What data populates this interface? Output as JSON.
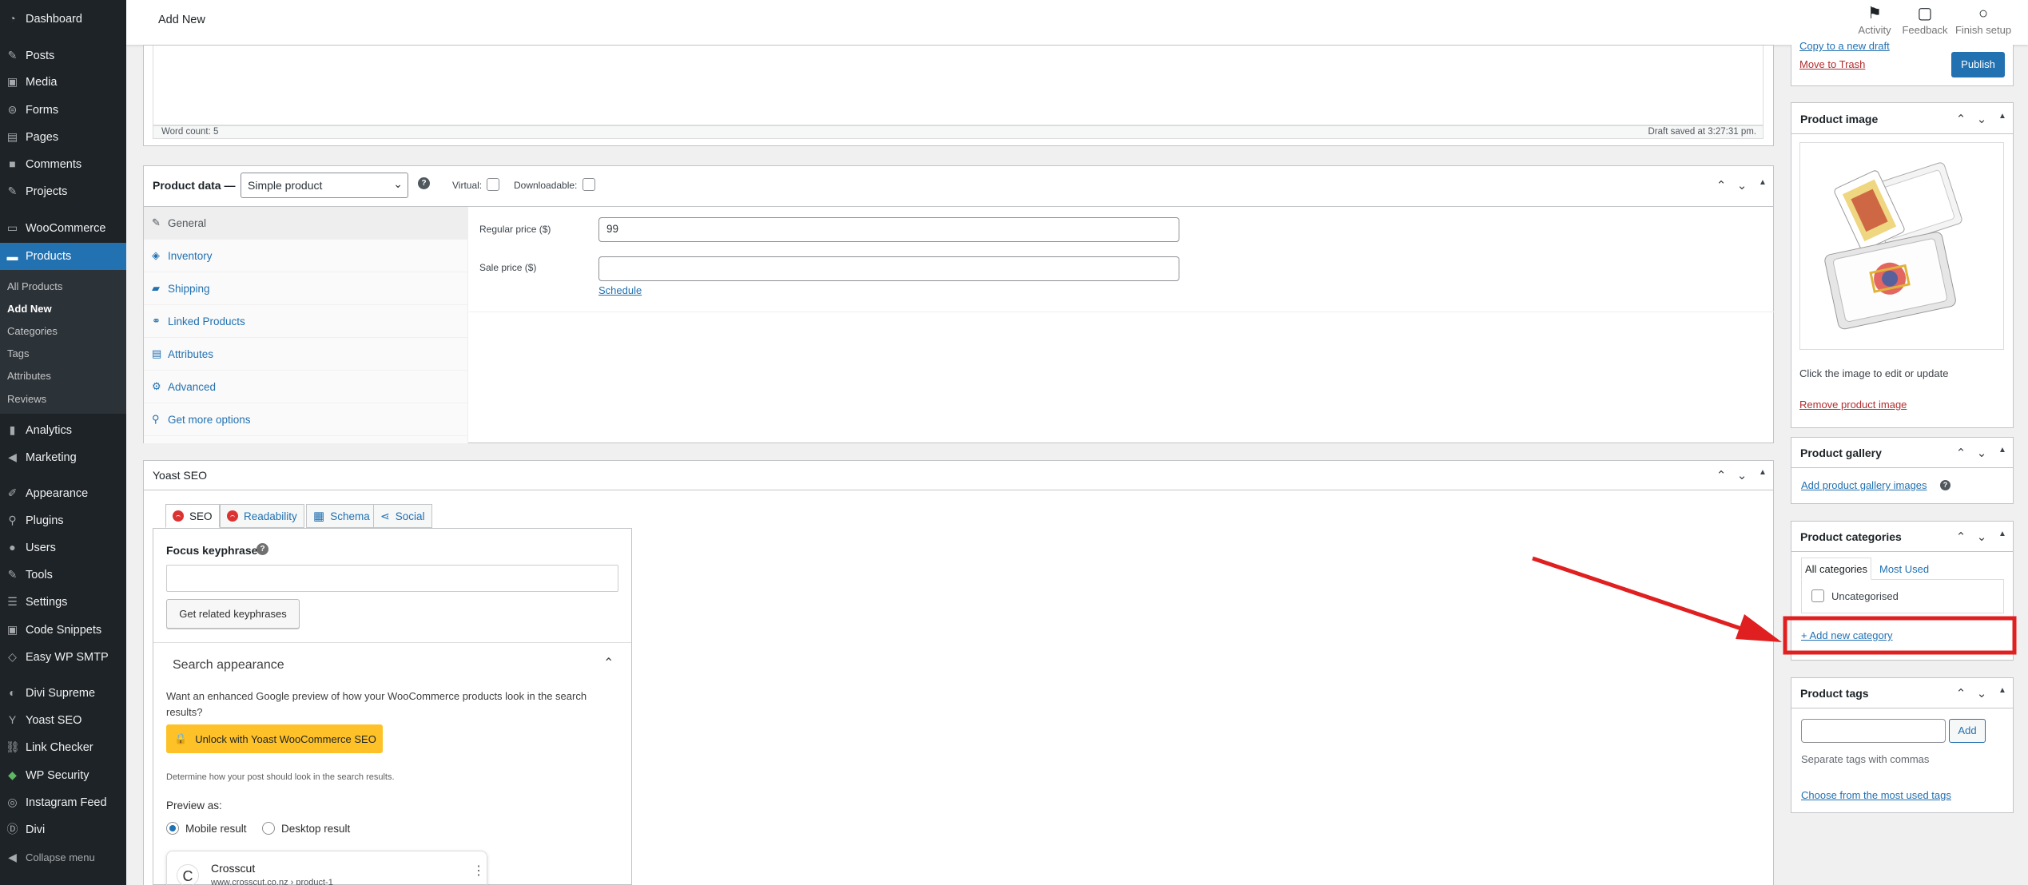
{
  "sidebar": {
    "items": [
      {
        "label": "Dashboard",
        "icon": "dashboard-icon"
      },
      {
        "label": "Posts",
        "icon": "pin-icon"
      },
      {
        "label": "Media",
        "icon": "media-icon"
      },
      {
        "label": "Forms",
        "icon": "forms-icon"
      },
      {
        "label": "Pages",
        "icon": "page-icon"
      },
      {
        "label": "Comments",
        "icon": "comment-icon"
      },
      {
        "label": "Projects",
        "icon": "pin-icon"
      },
      {
        "label": "WooCommerce",
        "icon": "woo-icon"
      },
      {
        "label": "Products",
        "icon": "archive-icon"
      },
      {
        "label": "Analytics",
        "icon": "bar-chart-icon"
      },
      {
        "label": "Marketing",
        "icon": "megaphone-icon"
      },
      {
        "label": "Appearance",
        "icon": "brush-icon"
      },
      {
        "label": "Plugins",
        "icon": "plugin-icon"
      },
      {
        "label": "Users",
        "icon": "user-icon"
      },
      {
        "label": "Tools",
        "icon": "wrench-icon"
      },
      {
        "label": "Settings",
        "icon": "sliders-icon"
      },
      {
        "label": "Code Snippets",
        "icon": "code-icon"
      },
      {
        "label": "Easy WP SMTP",
        "icon": "mail-icon"
      },
      {
        "label": "Divi Supreme",
        "icon": "divi-supreme-icon"
      },
      {
        "label": "Yoast SEO",
        "icon": "yoast-icon"
      },
      {
        "label": "Link Checker",
        "icon": "link-icon"
      },
      {
        "label": "WP Security",
        "icon": "shield-icon"
      },
      {
        "label": "Instagram Feed",
        "icon": "instagram-icon"
      },
      {
        "label": "Divi",
        "icon": "divi-icon"
      },
      {
        "label": "Collapse menu",
        "icon": "collapse-icon"
      }
    ],
    "products_submenu": [
      "All Products",
      "Add New",
      "Categories",
      "Tags",
      "Attributes",
      "Reviews"
    ]
  },
  "topbar": {
    "title": "Add New",
    "tools": [
      {
        "label": "Activity",
        "icon": "flag-icon"
      },
      {
        "label": "Feedback",
        "icon": "feedback-icon"
      },
      {
        "label": "Finish setup",
        "icon": "circle-icon"
      }
    ]
  },
  "editor": {
    "word_count": "Word count: 5",
    "draft_saved": "Draft saved at 3:27:31 pm."
  },
  "product_data": {
    "title": "Product data —",
    "type_value": "Simple product",
    "virtual_label": "Virtual:",
    "downloadable_label": "Downloadable:",
    "tabs": [
      {
        "label": "General",
        "icon": "wrench-icon"
      },
      {
        "label": "Inventory",
        "icon": "tag-icon"
      },
      {
        "label": "Shipping",
        "icon": "truck-icon"
      },
      {
        "label": "Linked Products",
        "icon": "link-icon"
      },
      {
        "label": "Attributes",
        "icon": "list-icon"
      },
      {
        "label": "Advanced",
        "icon": "gear-icon"
      },
      {
        "label": "Get more options",
        "icon": "plugin-icon"
      }
    ],
    "regular_price_label": "Regular price ($)",
    "regular_price_value": "99",
    "sale_price_label": "Sale price ($)",
    "sale_price_value": "",
    "schedule_link": "Schedule"
  },
  "yoast": {
    "title": "Yoast SEO",
    "tabs": [
      "SEO",
      "Readability",
      "Schema",
      "Social"
    ],
    "focus_keyphrase_label": "Focus keyphrase",
    "focus_keyphrase_value": "",
    "related_button": "Get related keyphrases",
    "search_appearance_title": "Search appearance",
    "enhanced_text": "Want an enhanced Google preview of how your WooCommerce products look in the search results?",
    "unlock_button": "Unlock with Yoast WooCommerce SEO",
    "determine_text": "Determine how your post should look in the search results.",
    "preview_as": "Preview as:",
    "mobile_result": "Mobile result",
    "desktop_result": "Desktop result",
    "preview_site": "Crosscut",
    "preview_url": "www.crosscut.co.nz › product-1",
    "preview_favicon_letter": "C"
  },
  "publish": {
    "copy_link": "Copy to a new draft",
    "trash_link": "Move to Trash",
    "publish_button": "Publish"
  },
  "product_image": {
    "title": "Product image",
    "hint": "Click the image to edit or update",
    "remove_link": "Remove product image"
  },
  "product_gallery": {
    "title": "Product gallery",
    "add_link": "Add product gallery images"
  },
  "product_categories": {
    "title": "Product categories",
    "tab_all": "All categories",
    "tab_most_used": "Most Used",
    "items": [
      "Uncategorised"
    ],
    "add_new_link": "+ Add new category"
  },
  "product_tags": {
    "title": "Product tags",
    "input_value": "",
    "add_button": "Add",
    "separate_text": "Separate tags with commas",
    "choose_link": "Choose from the most used tags"
  },
  "colors": {
    "sidebar_bg": "#1d2327",
    "accent": "#2271b1",
    "annotation_red": "#e02020",
    "yoast_yellow": "#fec228",
    "error_red": "#dc3232"
  }
}
